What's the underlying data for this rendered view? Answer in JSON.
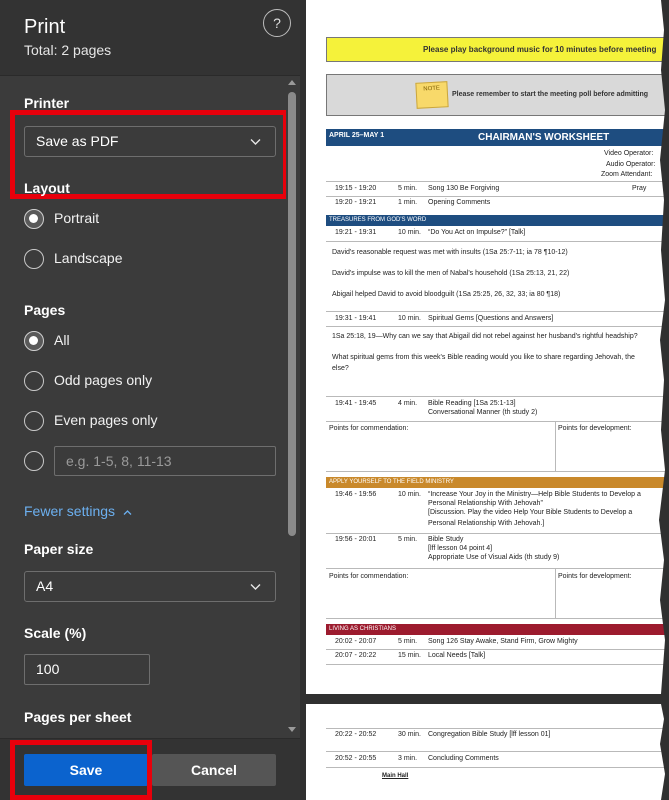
{
  "panel": {
    "title": "Print",
    "subtitle": "Total: 2 pages",
    "help_icon": "?",
    "printer_label": "Printer",
    "printer_value": "Save as PDF",
    "layout_label": "Layout",
    "layout_options": [
      "Portrait",
      "Landscape"
    ],
    "layout_selected": "Portrait",
    "pages_label": "Pages",
    "pages_options": [
      "All",
      "Odd pages only",
      "Even pages only"
    ],
    "pages_selected": "All",
    "custom_pages_placeholder": "e.g. 1-5, 8, 11-13",
    "fewer_settings": "Fewer settings",
    "paper_size_label": "Paper size",
    "paper_size_value": "A4",
    "scale_label": "Scale (%)",
    "scale_value": "100",
    "pages_per_sheet_label": "Pages per sheet",
    "save_label": "Save",
    "cancel_label": "Cancel"
  },
  "colors": {
    "accent": "#0b63ce",
    "highlight": "#e8000b",
    "link": "#6cb0f0",
    "section_treasures": "#1e4d80",
    "section_ministry": "#c9892b",
    "section_living": "#9c1b2e"
  },
  "preview": {
    "banner_yellow": "Please play background music for 10 minutes before meeting",
    "banner_grey": "Please remember to start the meeting poll before admitting",
    "note_text": "NOTE",
    "worksheet_date": "APRIL 25–MAY 1",
    "worksheet_title": "CHAIRMAN'S WORKSHEET",
    "right_labels": [
      "Video Operator:",
      "Audio Operator:",
      "Zoom Attendant:"
    ],
    "prayer": "Pray",
    "rows_opening": [
      {
        "time": "19:15 - 19:20",
        "min": "5 min.",
        "text": "Song  130  Be Forgiving"
      },
      {
        "time": "19:20 - 19:21",
        "min": "1 min.",
        "text": "Opening Comments"
      }
    ],
    "treasures_title": "TREASURES FROM GOD'S WORD",
    "treasures_talk": {
      "time": "19:21 - 19:31",
      "min": "10 min.",
      "text": "“Do You Act on Impulse?”  [Talk]"
    },
    "treasures_points": [
      "David's reasonable request was met with insults (1Sa 25:7-11; ia 78 ¶10-12)",
      "David's impulse was to kill the men of Nabal's household (1Sa 25:13, 21, 22)",
      "Abigail helped David to avoid bloodguilt (1Sa 25:25, 26, 32, 33; ia 80 ¶18)"
    ],
    "gems": {
      "time": "19:31 - 19:41",
      "min": "10 min.",
      "text": "Spiritual Gems  [Questions and Answers]"
    },
    "gems_points": [
      "1Sa 25:18, 19—Why can we say that Abigail did not rebel against her husband's rightful headship?",
      "What spiritual gems from this week's Bible reading would you like to share regarding Jehovah, the",
      "else?"
    ],
    "bible_reading": {
      "time": "19:41 - 19:45",
      "min": "4 min.",
      "text": "Bible Reading  [1Sa 25:1-13]",
      "text2": "Conversational Manner (th study 2)"
    },
    "commendation": "Points for commendation:",
    "development": "Points for development:",
    "ministry_title": "APPLY YOURSELF TO THE FIELD MINISTRY",
    "ministry_1": {
      "time": "19:46 - 19:56",
      "min": "10 min.",
      "text": "“Increase Your Joy in the Ministry—Help Bible Students to Develop a",
      "text2": "Personal Relationship With Jehovah”",
      "text3": "[Discussion. Play the video Help Your Bible Students to Develop a"
    },
    "ministry_1_text4": "Personal Relationship With Jehovah.]",
    "ministry_2": {
      "time": "19:56 - 20:01",
      "min": "5 min.",
      "text": "Bible Study",
      "text2": "[lff lesson 04 point 4]",
      "text3": "Appropriate Use of Visual Aids (th study 9)"
    },
    "living_title": "LIVING AS CHRISTIANS",
    "living_rows": [
      {
        "time": "20:02 - 20:07",
        "min": "5 min.",
        "text": "Song  126  Stay Awake, Stand Firm, Grow Mighty"
      },
      {
        "time": "20:07 - 20:22",
        "min": "15 min.",
        "text": "Local Needs  [Talk]"
      }
    ],
    "page2_rows": [
      {
        "time": "20:22 - 20:52",
        "min": "30 min.",
        "text": "Congregation Bible Study  [lff lesson 01]"
      },
      {
        "time": "20:52 - 20:55",
        "min": "3 min.",
        "text": "Concluding Comments"
      }
    ],
    "main_hall": "Main Hall"
  }
}
